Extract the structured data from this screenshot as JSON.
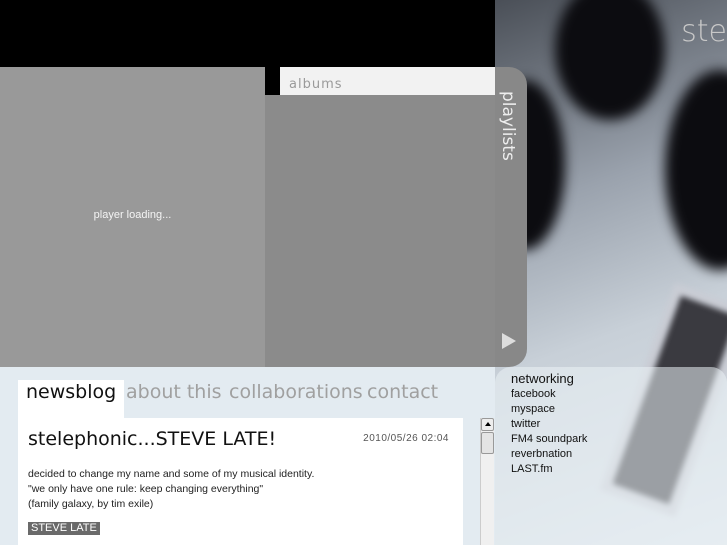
{
  "brand": {
    "logo_text": "ste"
  },
  "player": {
    "status": "player loading..."
  },
  "albums": {
    "tab_label": "albums"
  },
  "playlists": {
    "tab_label": "playlists"
  },
  "nav": {
    "tabs": [
      {
        "label": "newsblog",
        "active": true
      },
      {
        "label": "about this"
      },
      {
        "label": "collaborations"
      },
      {
        "label": "contact"
      }
    ]
  },
  "post": {
    "title": "stelephonic...STEVE LATE!",
    "date": "2010/05/26 02:04",
    "lines": [
      "decided to change my name and some of my musical identity.",
      "\"we only have one rule: keep changing everything\"",
      "(family galaxy, by tim exile)"
    ],
    "tag": "STEVE LATE"
  },
  "networking": {
    "heading": "networking",
    "links": [
      "facebook",
      "myspace",
      "twitter",
      "FM4 soundpark",
      "reverbnation",
      "LAST.fm"
    ]
  }
}
